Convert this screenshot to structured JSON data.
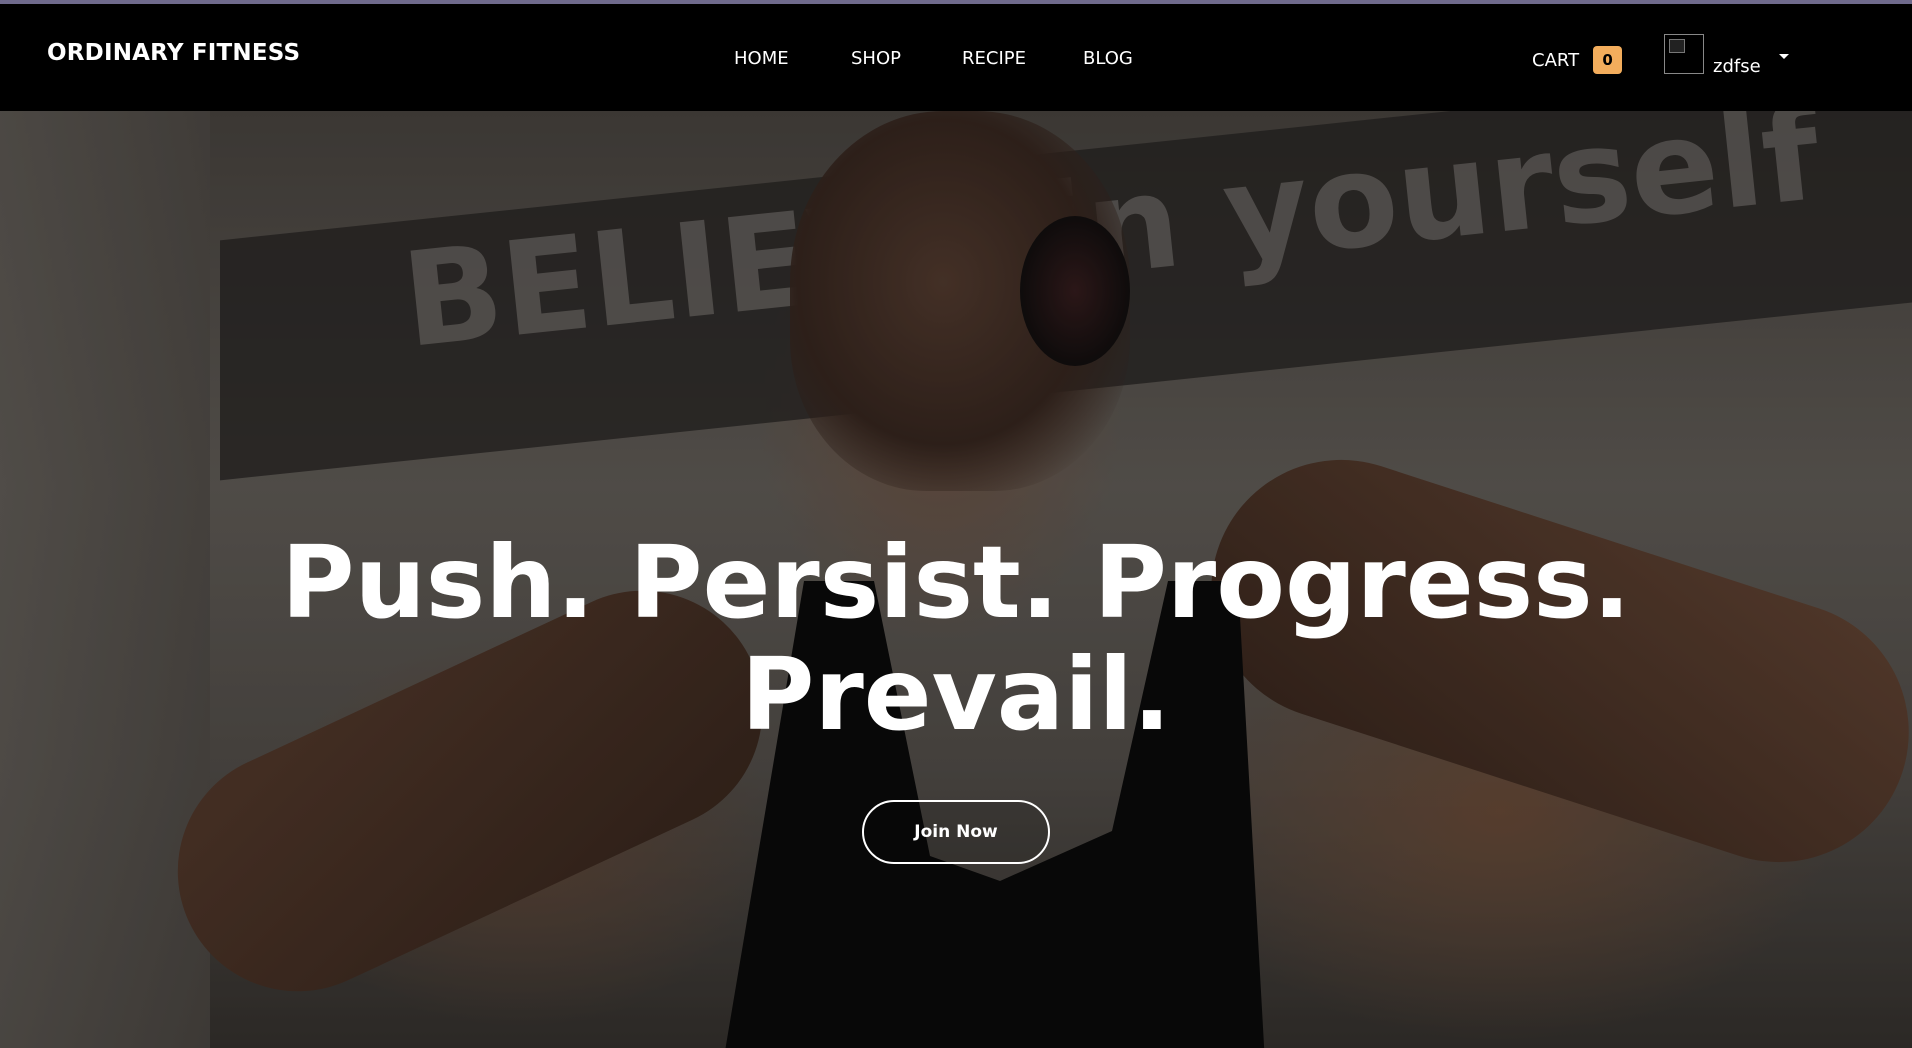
{
  "brand": {
    "name": "ORDINARY FITNESS"
  },
  "nav": {
    "links": [
      {
        "label": "HOME"
      },
      {
        "label": "SHOP"
      },
      {
        "label": "RECIPE"
      },
      {
        "label": "BLOG"
      }
    ]
  },
  "cart": {
    "label": "CART",
    "count": "0"
  },
  "user": {
    "name": "zdfse",
    "avatar_icon": "broken-image-icon",
    "menu_icon": "caret-down-icon"
  },
  "hero": {
    "banner_text": "BELIEVE in yourself",
    "title_line1": "Push. Persist. Progress.",
    "title_line2": "Prevail.",
    "cta_label": "Join Now"
  },
  "colors": {
    "navbar_bg": "#000000",
    "cart_badge_bg": "#f3ad5c",
    "text": "#ffffff"
  }
}
